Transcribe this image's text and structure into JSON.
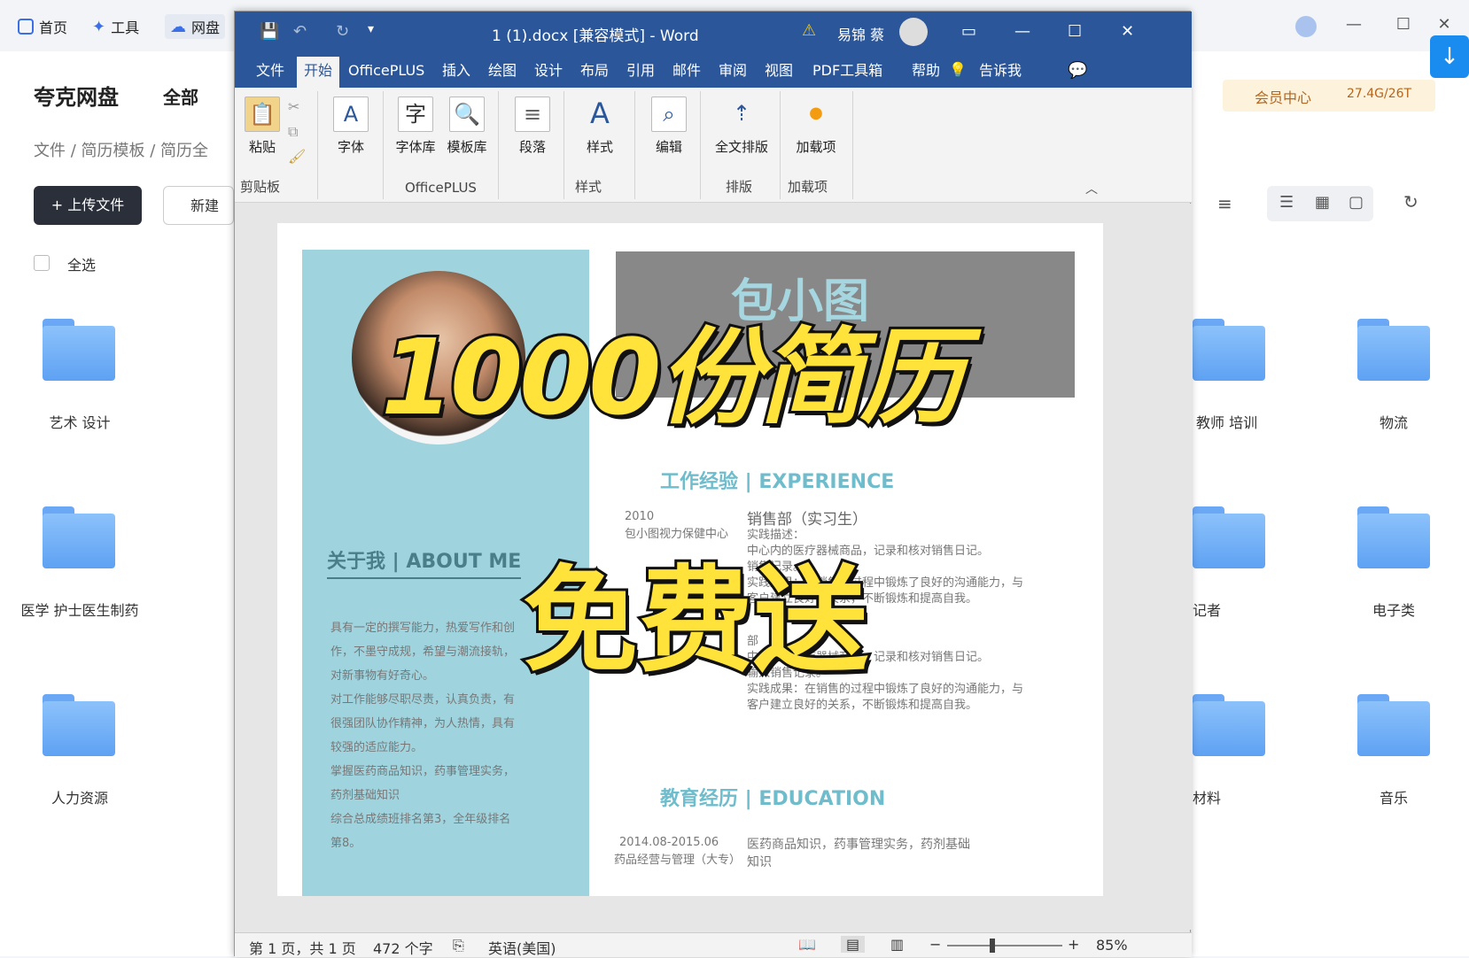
{
  "cloud": {
    "tabs": [
      "首页",
      "工具",
      "网盘"
    ],
    "title": "夸克网盘",
    "all_label": "全部",
    "breadcrumb": [
      "文件",
      "简历模板",
      "简历全"
    ],
    "upload_label": "+ 上传文件",
    "new_label": "新建",
    "select_all": "全选",
    "member_center": "会员中心",
    "storage": "27.4G/26T",
    "folders_left": [
      "艺术 设计",
      "医学 护士医生制药",
      "人力资源"
    ],
    "folders_right_partial": [
      "教师 培训",
      "记者",
      "材料"
    ],
    "folders_right": [
      "物流",
      "电子类",
      "音乐"
    ]
  },
  "word": {
    "title": "1 (1).docx [兼容模式] - Word",
    "user": "易锦 蔡",
    "menus": [
      "文件",
      "开始",
      "OfficePLUS",
      "插入",
      "绘图",
      "设计",
      "布局",
      "引用",
      "邮件",
      "审阅",
      "视图",
      "PDF工具箱",
      "帮助",
      "告诉我"
    ],
    "active_menu": "开始",
    "ribbon": {
      "paste": "粘贴",
      "clipboard": "剪贴板",
      "font": "字体",
      "font_lib": "字体库",
      "template_lib": "模板库",
      "officeplus": "OfficePLUS",
      "paragraph": "段落",
      "styles": "样式",
      "styles_group": "样式",
      "edit": "编辑",
      "full_layout": "全文排版",
      "layout_group": "排版",
      "addin": "加载项",
      "addin_group": "加载项"
    },
    "doc": {
      "name": "包小图",
      "about_title": "关于我 | ABOUT ME",
      "about_text": [
        "具有一定的撰写能力，热爱写作和创",
        "作，不墨守成规，希望与潮流接轨，",
        "对新事物有好奇心。",
        "对工作能够尽职尽责，认真负责，有",
        "很强团队协作精神，为人热情，具有",
        "较强的适应能力。",
        "掌握医药商品知识，药事管理实务，",
        "药剂基础知识",
        "综合总成绩班排名第3，全年级排名",
        "第8。"
      ],
      "exp_title": "工作经验 | EXPERIENCE",
      "exp_year": "2010",
      "exp_company": "包小图视力保健中心",
      "exp_role": "销售部（实习生）",
      "exp_lines": [
        "实践描述：",
        "中心内的医疗器械商品，记录和核对销售日记。",
        "销售记录。",
        "实践成果：在销售的过程中锻炼了良好的沟通能力，与",
        "客户建立良好的关系，不断锻炼和提高自我。"
      ],
      "exp_lines2": [
        "部",
        "中心内的医疗器械商品，记录和核对销售日记。",
        "输入销售记录。",
        "实践成果：在销售的过程中锻炼了良好的沟通能力，与",
        "客户建立良好的关系，不断锻炼和提高自我。"
      ],
      "edu_title": "教育经历 | EDUCATION",
      "edu_date": "2014.08-2015.06",
      "edu_school": "药品经营与管理（大专）",
      "edu_text": "医药商品知识，药事管理实务，药剂基础",
      "edu_text2": "知识"
    },
    "status": {
      "page": "第 1 页，共 1 页",
      "words": "472 个字",
      "lang": "英语(美国)",
      "zoom": "85%"
    }
  },
  "overlay": {
    "line1": "1000份简历",
    "line2": "免费送"
  },
  "colors": {
    "word_blue": "#2b579a",
    "resume_teal": "#9fd4df",
    "overlay_yellow": "#ffe23a"
  }
}
